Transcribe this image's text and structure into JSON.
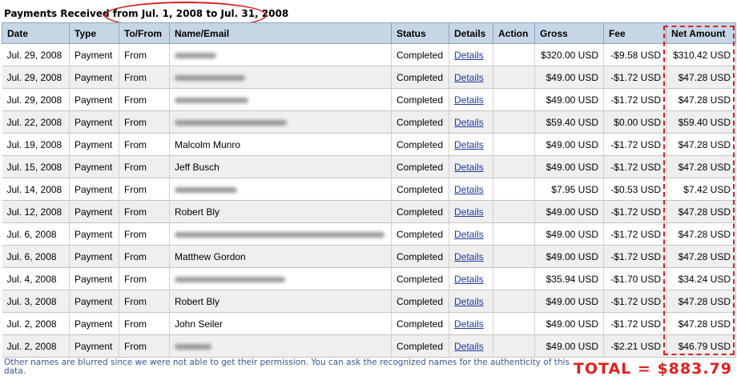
{
  "header": {
    "title_prefix": "Payments Received from ",
    "title_range": "Jul. 1, 2008 to Jul. 31, 2008"
  },
  "columns": [
    "Date",
    "Type",
    "To/From",
    "Name/Email",
    "Status",
    "Details",
    "Action",
    "Gross",
    "Fee",
    "Net Amount"
  ],
  "rows": [
    {
      "date": "Jul. 29, 2008",
      "type": "Payment",
      "tofrom": "From",
      "name": "",
      "status": "Completed",
      "details": "Details",
      "action": "",
      "gross": "$320.00 USD",
      "fee": "-$9.58 USD",
      "net": "$310.42 USD"
    },
    {
      "date": "Jul. 29, 2008",
      "type": "Payment",
      "tofrom": "From",
      "name": "",
      "status": "Completed",
      "details": "Details",
      "action": "",
      "gross": "$49.00 USD",
      "fee": "-$1.72 USD",
      "net": "$47.28 USD"
    },
    {
      "date": "Jul. 29, 2008",
      "type": "Payment",
      "tofrom": "From",
      "name": "",
      "status": "Completed",
      "details": "Details",
      "action": "",
      "gross": "$49.00 USD",
      "fee": "-$1.72 USD",
      "net": "$47.28 USD"
    },
    {
      "date": "Jul. 22, 2008",
      "type": "Payment",
      "tofrom": "From",
      "name": "",
      "status": "Completed",
      "details": "Details",
      "action": "",
      "gross": "$59.40 USD",
      "fee": "$0.00 USD",
      "net": "$59.40 USD"
    },
    {
      "date": "Jul. 19, 2008",
      "type": "Payment",
      "tofrom": "From",
      "name": "Malcolm Munro",
      "status": "Completed",
      "details": "Details",
      "action": "",
      "gross": "$49.00 USD",
      "fee": "-$1.72 USD",
      "net": "$47.28 USD"
    },
    {
      "date": "Jul. 15, 2008",
      "type": "Payment",
      "tofrom": "From",
      "name": "Jeff Busch",
      "status": "Completed",
      "details": "Details",
      "action": "",
      "gross": "$49.00 USD",
      "fee": "-$1.72 USD",
      "net": "$47.28 USD"
    },
    {
      "date": "Jul. 14, 2008",
      "type": "Payment",
      "tofrom": "From",
      "name": "",
      "status": "Completed",
      "details": "Details",
      "action": "",
      "gross": "$7.95 USD",
      "fee": "-$0.53 USD",
      "net": "$7.42 USD"
    },
    {
      "date": "Jul. 12, 2008",
      "type": "Payment",
      "tofrom": "From",
      "name": "Robert Bly",
      "status": "Completed",
      "details": "Details",
      "action": "",
      "gross": "$49.00 USD",
      "fee": "-$1.72 USD",
      "net": "$47.28 USD"
    },
    {
      "date": "Jul. 6, 2008",
      "type": "Payment",
      "tofrom": "From",
      "name": "",
      "status": "Completed",
      "details": "Details",
      "action": "",
      "gross": "$49.00 USD",
      "fee": "-$1.72 USD",
      "net": "$47.28 USD"
    },
    {
      "date": "Jul. 6, 2008",
      "type": "Payment",
      "tofrom": "From",
      "name": "Matthew Gordon",
      "status": "Completed",
      "details": "Details",
      "action": "",
      "gross": "$49.00 USD",
      "fee": "-$1.72 USD",
      "net": "$47.28 USD"
    },
    {
      "date": "Jul. 4, 2008",
      "type": "Payment",
      "tofrom": "From",
      "name": "",
      "status": "Completed",
      "details": "Details",
      "action": "",
      "gross": "$35.94 USD",
      "fee": "-$1.70 USD",
      "net": "$34.24 USD"
    },
    {
      "date": "Jul. 3, 2008",
      "type": "Payment",
      "tofrom": "From",
      "name": "Robert Bly",
      "status": "Completed",
      "details": "Details",
      "action": "",
      "gross": "$49.00 USD",
      "fee": "-$1.72 USD",
      "net": "$47.28 USD"
    },
    {
      "date": "Jul. 2, 2008",
      "type": "Payment",
      "tofrom": "From",
      "name": "John Seiler",
      "status": "Completed",
      "details": "Details",
      "action": "",
      "gross": "$49.00 USD",
      "fee": "-$1.72 USD",
      "net": "$47.28 USD"
    },
    {
      "date": "Jul. 2, 2008",
      "type": "Payment",
      "tofrom": "From",
      "name": "",
      "status": "Completed",
      "details": "Details",
      "action": "",
      "gross": "$49.00 USD",
      "fee": "-$2.21 USD",
      "net": "$46.79 USD"
    }
  ],
  "footer": {
    "note": "Other names are blurred since we were not able to get their permission. You can ask the recognized names for the authenticity of this data.",
    "total_label": "TOTAL =",
    "total_value": "$883.79"
  },
  "colors": {
    "header_bg": "#c7d6e6",
    "row_alt_bg": "#efefef",
    "annotation_red": "#d32020",
    "link_blue": "#1a3a9c",
    "footnote_blue": "#35559a"
  }
}
